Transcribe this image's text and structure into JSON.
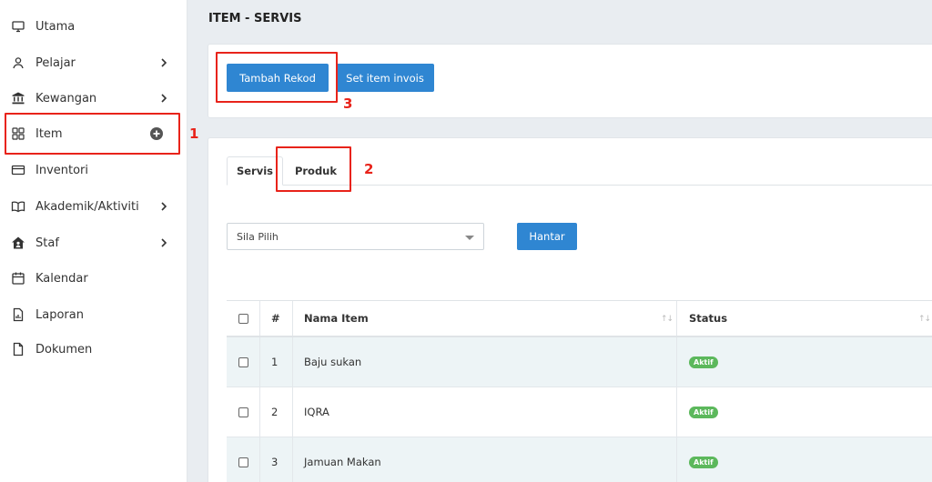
{
  "sidebar": {
    "items": [
      {
        "label": "Utama",
        "icon": "monitor-icon"
      },
      {
        "label": "Pelajar",
        "icon": "user-icon",
        "chevron": true
      },
      {
        "label": "Kewangan",
        "icon": "bank-icon",
        "chevron": true
      },
      {
        "label": "Item",
        "icon": "grid-icon",
        "plus": true
      },
      {
        "label": "Inventori",
        "icon": "card-icon"
      },
      {
        "label": "Akademik/Aktiviti",
        "icon": "book-icon",
        "chevron": true
      },
      {
        "label": "Staf",
        "icon": "house-icon",
        "chevron": true
      },
      {
        "label": "Kalendar",
        "icon": "calendar-icon"
      },
      {
        "label": "Laporan",
        "icon": "report-icon"
      },
      {
        "label": "Dokumen",
        "icon": "document-icon"
      }
    ]
  },
  "header": {
    "title": "ITEM - SERVIS"
  },
  "toolbar": {
    "tambah_label": "Tambah Rekod",
    "set_label": "Set item invois"
  },
  "tabs": [
    {
      "label": "Servis",
      "active": true
    },
    {
      "label": "Produk",
      "active": false
    }
  ],
  "filter": {
    "select_value": "Sila Pilih",
    "submit_label": "Hantar"
  },
  "table": {
    "columns": [
      "#",
      "Nama Item",
      "Status"
    ],
    "rows": [
      {
        "no": "1",
        "name": "Baju sukan",
        "status": "Aktif"
      },
      {
        "no": "2",
        "name": "IQRA",
        "status": "Aktif"
      },
      {
        "no": "3",
        "name": "Jamuan Makan",
        "status": "Aktif"
      }
    ]
  },
  "annotations": {
    "one": "1",
    "two": "2",
    "three": "3"
  },
  "colors": {
    "accent": "#2f86d2",
    "annotation": "#e8231a",
    "status_active": "#5cb85c"
  }
}
